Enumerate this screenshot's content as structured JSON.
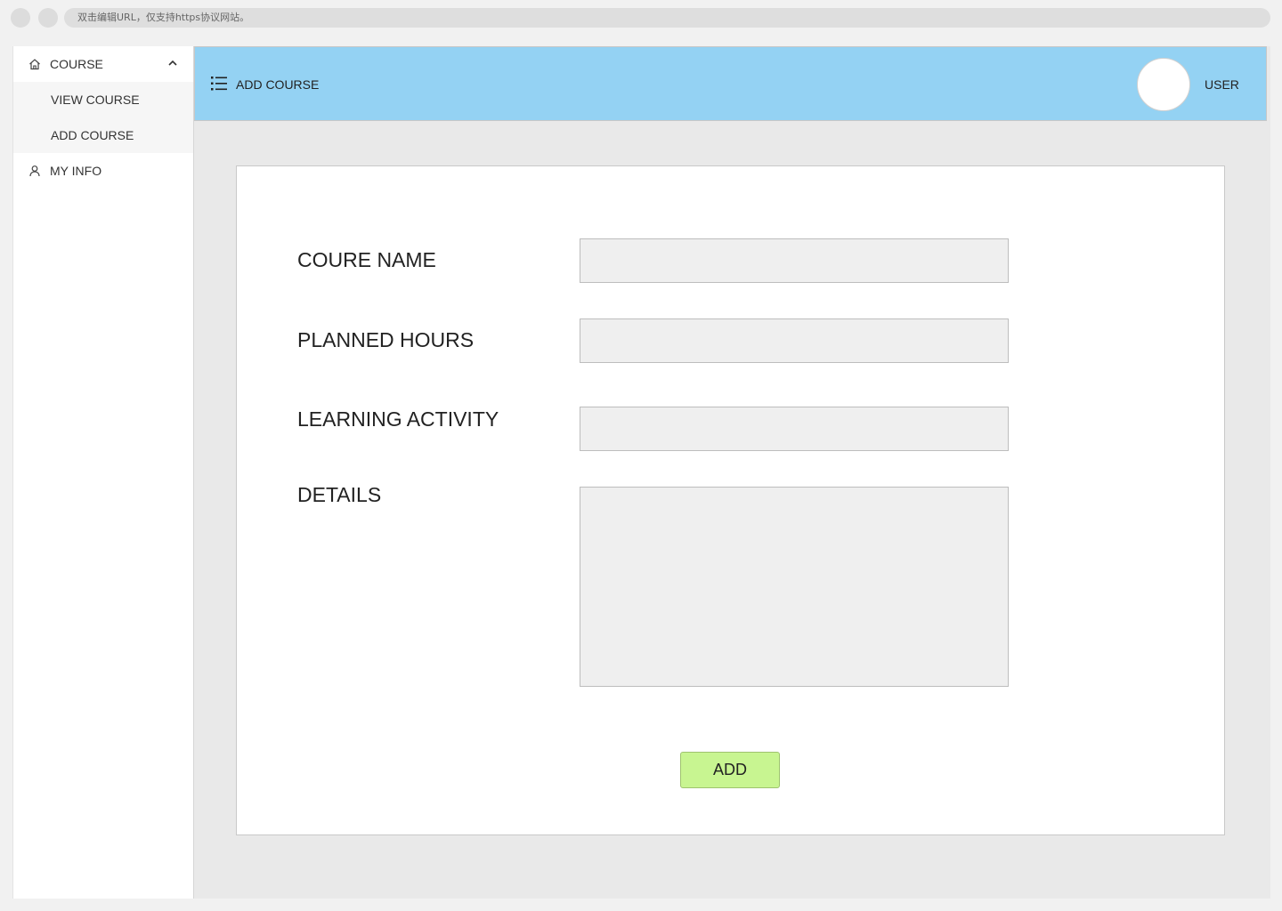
{
  "browser": {
    "url_hint": "双击编辑URL，仅支持https协议网站。"
  },
  "sidebar": {
    "items": [
      {
        "label": "COURSE",
        "icon": "home-icon",
        "expanded": true,
        "children": [
          {
            "label": "VIEW COURSE"
          },
          {
            "label": "ADD COURSE"
          }
        ]
      },
      {
        "label": "MY INFO",
        "icon": "user-icon"
      }
    ]
  },
  "header": {
    "title": "ADD COURSE",
    "user_label": "USER",
    "colors": {
      "background": "#94d2f3"
    }
  },
  "form": {
    "fields": [
      {
        "label": "COURE NAME",
        "value": ""
      },
      {
        "label": "PLANNED HOURS",
        "value": ""
      },
      {
        "label": "LEARNING ACTIVITY",
        "value": ""
      },
      {
        "label": "DETAILS",
        "value": ""
      }
    ],
    "submit_label": "ADD",
    "colors": {
      "submit_background": "#c8f591",
      "input_background": "#efefef"
    }
  }
}
